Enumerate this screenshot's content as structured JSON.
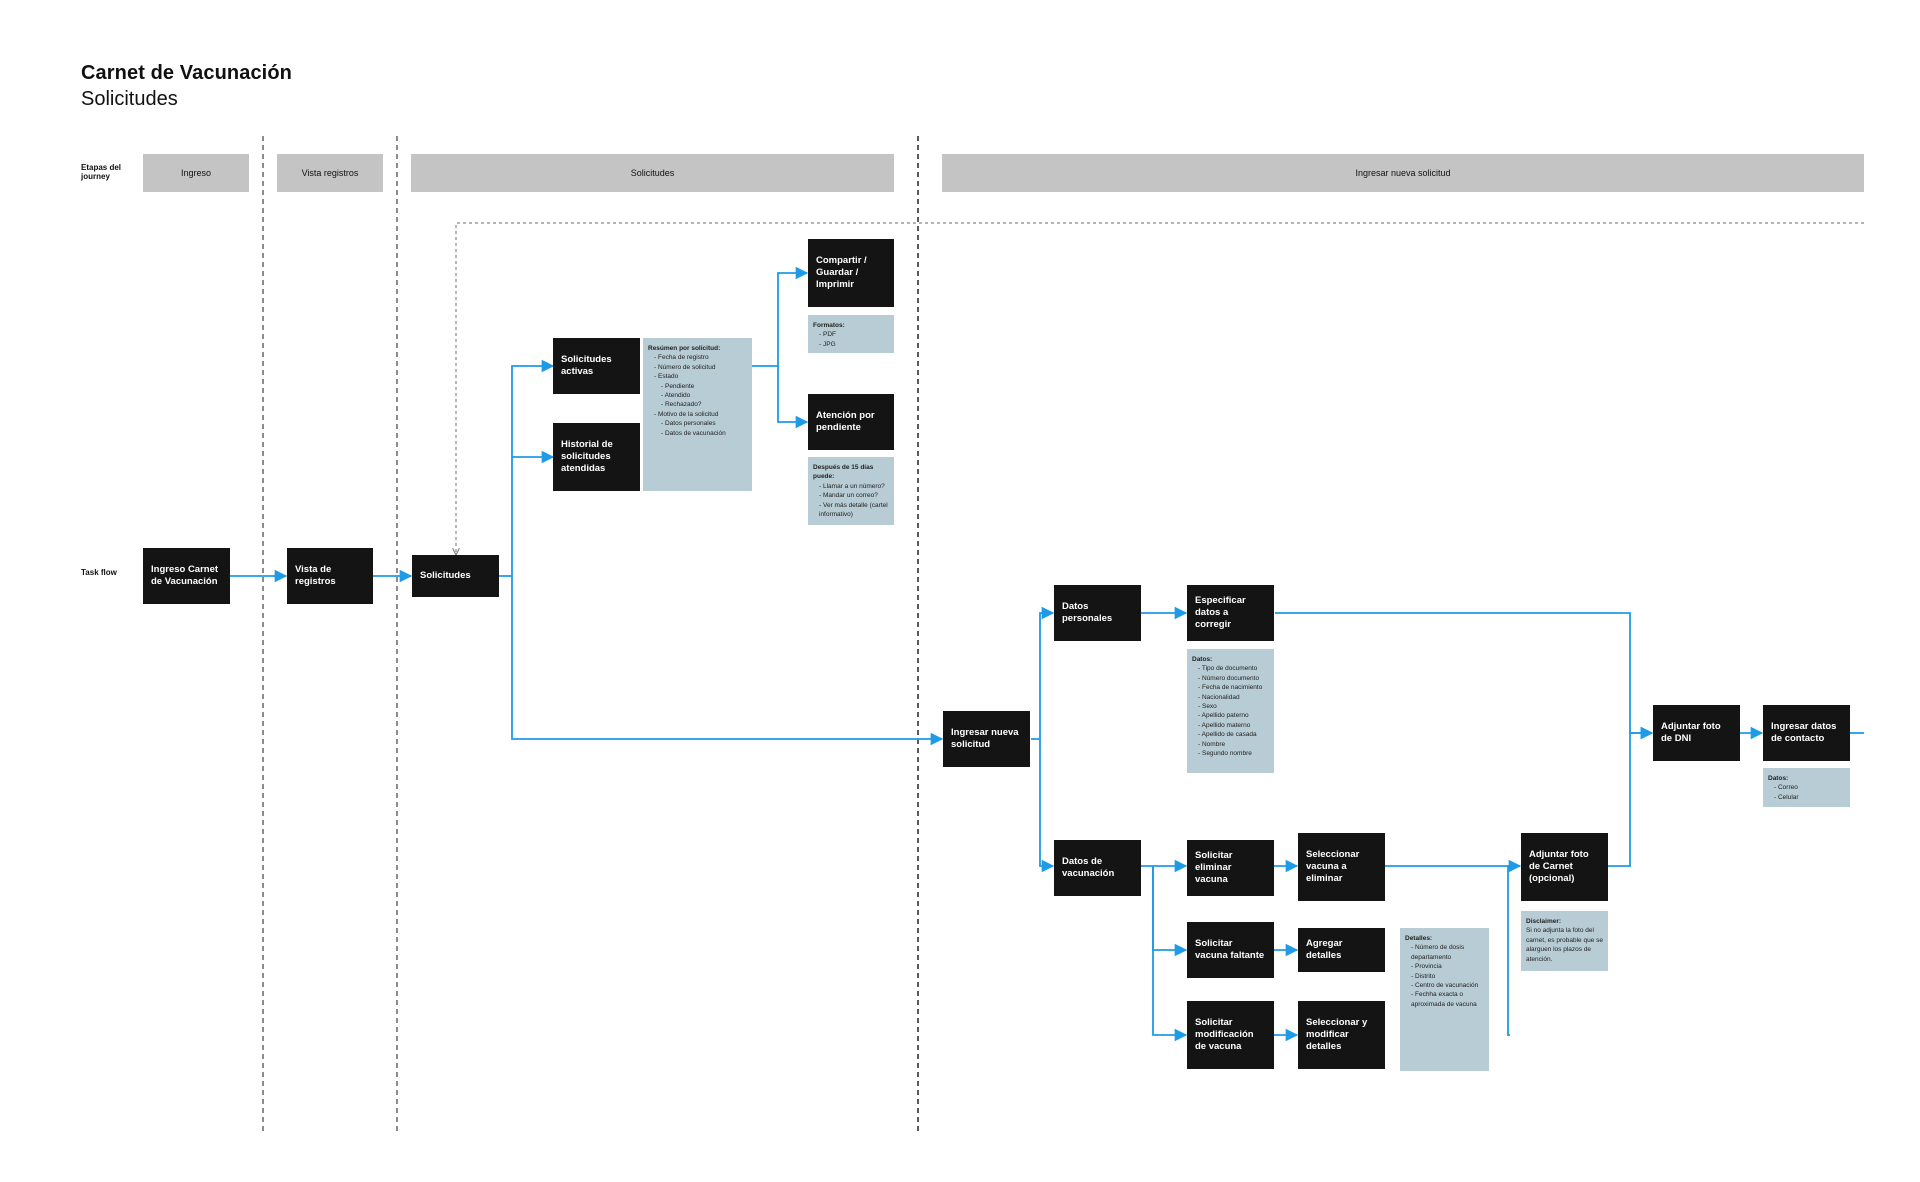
{
  "header": {
    "title": "Carnet de Vacunación",
    "subtitle": "Solicitudes"
  },
  "row_labels": {
    "stages": "Etapas del journey",
    "taskflow": "Task flow"
  },
  "stages": [
    "Ingreso",
    "Vista registros",
    "Solicitudes",
    "Ingresar nueva solicitud"
  ],
  "nodes": {
    "ingreso": "Ingreso Carnet de Vacunación",
    "vista": "Vista de registros",
    "solicitudes": "Solicitudes",
    "activas": "Solicitudes activas",
    "historial": "Historial de solicitudes atendidas",
    "compartir": "Compartir / Guardar / Imprimir",
    "atencion": "Atención por pendiente",
    "nueva": "Ingresar nueva solicitud",
    "personales": "Datos personales",
    "especificar": "Especificar datos a corregir",
    "vacunacion": "Datos de vacunación",
    "eliminar": "Solicitar eliminar vacuna",
    "sel_eliminar": "Seleccionar vacuna a eliminar",
    "faltante": "Solicitar vacuna faltante",
    "agregar": "Agregar detalles",
    "modificacion": "Solicitar modificación de vacuna",
    "sel_modificar": "Seleccionar y modificar detalles",
    "carnet": "Adjuntar foto de Carnet (opcional)",
    "dni": "Adjuntar foto de DNI",
    "contacto": "Ingresar datos de contacto"
  },
  "notes": {
    "resumen": {
      "title": "Resúmen por solicitud:",
      "items": [
        "Fecha de registro",
        "Número de solicitud",
        "Estado"
      ],
      "estados": [
        "Pendiente",
        "Atendido",
        "Rechazado?"
      ],
      "motivo": "Motivo de la solicitud",
      "motivos": [
        "Datos personales",
        "Datos de vacunación"
      ]
    },
    "formatos": {
      "title": "Formatos:",
      "items": [
        "PDF",
        "JPG"
      ]
    },
    "despues": {
      "title": "Después de 15 días puede:",
      "items": [
        "Llamar a un número?",
        "Mandar un correo?",
        "Ver más detalle (cartel informativo)"
      ]
    },
    "datos": {
      "title": "Datos:",
      "items": [
        "Tipo de documento",
        "Número documento",
        "Fecha de nacimiento",
        "Nacionalidad",
        "Sexo",
        "Apellido paterno",
        "Apellido materno",
        "Apellido de casada",
        "Nombre",
        "Segundo nombre"
      ]
    },
    "detalles": {
      "title": "Detalles:",
      "items": [
        "Número de dosis departamento",
        "Provincia",
        "Distrito",
        "Centro de vacunación",
        "Fechha exacta o aproximada de vacuna"
      ]
    },
    "disclaimer": {
      "title": "Disclaimer:",
      "text": "Si no adjunta la foto del carnet, es probable que se alarguen los plazos de atención."
    },
    "contacto": {
      "title": "Datos:",
      "items": [
        "Correo",
        "Celular"
      ]
    }
  },
  "colors": {
    "node": "#141414",
    "note": "#b7ccd4",
    "stage": "#c4c4c4",
    "arrow": "#1e9be6"
  }
}
